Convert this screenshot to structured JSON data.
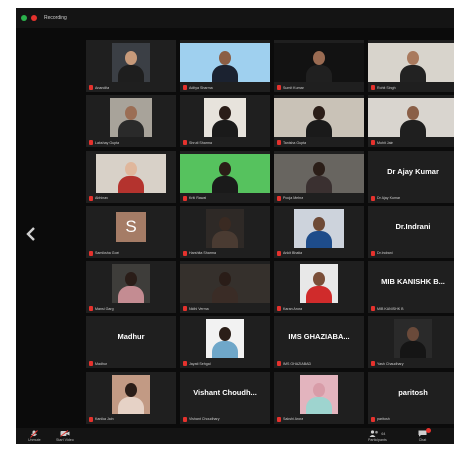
{
  "window": {
    "recording_label": "Recording"
  },
  "participants": [
    {
      "id": "p1",
      "name": "Anandita",
      "bg": "#3b3f45",
      "inset": [
        26,
        26
      ],
      "head": "#c79a7a",
      "body": "#1e1e1e"
    },
    {
      "id": "p2",
      "name": "Aditya Sharma",
      "bg": "#9fd0ef",
      "inset": [
        0,
        0
      ],
      "head": "#8b5e45",
      "body": "#1b2230"
    },
    {
      "id": "p3",
      "name": "Sumit Kumar",
      "bg": "#121212",
      "inset": [
        0,
        0
      ],
      "head": "#9a6b52",
      "body": "#202020"
    },
    {
      "id": "p4",
      "name": "Rohit Singh",
      "bg": "#d8d4cc",
      "inset": [
        0,
        0
      ],
      "head": "#a97a5e",
      "body": "#222222"
    },
    {
      "id": "p5",
      "name": "Lakshay Gupta",
      "bg": "#a8a39a",
      "inset": [
        24,
        24
      ],
      "head": "#9b6e55",
      "body": "#2a2a2a"
    },
    {
      "id": "p6",
      "name": "Shruti Sharma",
      "bg": "#e7e3dc",
      "inset": [
        24,
        24
      ],
      "head": "#2a1d18",
      "body": "#1a1a1a"
    },
    {
      "id": "p7",
      "name": "Tanisha Gupta",
      "bg": "#c9c2b7",
      "inset": [
        0,
        0
      ],
      "head": "#2b1e18",
      "body": "#1a1a1a"
    },
    {
      "id": "p8",
      "name": "Mohit Jain",
      "bg": "#d9d5cf",
      "inset": [
        0,
        0
      ],
      "head": "#8a5f47",
      "body": "#1f1f1f"
    },
    {
      "id": "p9",
      "name": "Abhinav",
      "bg": "#d8d1c8",
      "inset": [
        10,
        10
      ],
      "head": "#e0b79c",
      "body": "#b4332e"
    },
    {
      "id": "p10",
      "name": "Kriti Rawat",
      "bg": "#56c25e",
      "inset": [
        0,
        0
      ],
      "head": "#2a1d17",
      "body": "#1a1a1a"
    },
    {
      "id": "p11",
      "name": "Pooja Mehra",
      "bg": "#686560",
      "inset": [
        0,
        0
      ],
      "head": "#2b1e18",
      "body": "#3a3030"
    },
    {
      "id": "p12",
      "name": "Dr Ajay Kumar",
      "big": "Dr Ajay Kumar"
    },
    {
      "id": "p13",
      "name": "Samiksha Goel",
      "avatar": "S"
    },
    {
      "id": "p14",
      "name": "Harshita Sharma",
      "bg": "#2e2926",
      "inset": [
        26,
        26
      ],
      "head": "#3a2a22",
      "body": "#4a3b32"
    },
    {
      "id": "p15",
      "name": "Ankit Bhatia",
      "bg": "#cdd3dc",
      "inset": [
        20,
        20
      ],
      "head": "#6e4a36",
      "body": "#1e4c8a"
    },
    {
      "id": "p16",
      "name": "Dr.Indrani",
      "big": "Dr.Indrani"
    },
    {
      "id": "p17",
      "name": "Mansi Garg",
      "bg": "#3e3d3a",
      "inset": [
        26,
        26
      ],
      "head": "#2a1d18",
      "body": "#c48c92"
    },
    {
      "id": "p18",
      "name": "Nidhi Verma",
      "bg": "#35302c",
      "inset": [
        0,
        0
      ],
      "head": "#2a1d18",
      "body": "#3a2c26"
    },
    {
      "id": "p19",
      "name": "Karan Arora",
      "bg": "#e8e8e8",
      "inset": [
        26,
        26
      ],
      "head": "#7a4e38",
      "body": "#d02b2b"
    },
    {
      "id": "p20",
      "name": "MIB KANISHK B",
      "big": "MIB KANISHK B..."
    },
    {
      "id": "p21",
      "name": "Madhur",
      "big": "Madhur"
    },
    {
      "id": "p22",
      "name": "Jayati Sehgal",
      "bg": "#f2f2f2",
      "inset": [
        26,
        26
      ],
      "head": "#2b1e18",
      "body": "#6fa7c9"
    },
    {
      "id": "p23",
      "name": "IMS GHAZIABAD",
      "big": "IMS GHAZIABA..."
    },
    {
      "id": "p24",
      "name": "Yash Chaudhary",
      "bg": "#2a2a2a",
      "inset": [
        26,
        26
      ],
      "head": "#6a4a3a",
      "body": "#151515"
    },
    {
      "id": "p25",
      "name": "Kanika Jain",
      "bg": "#c29a84",
      "inset": [
        26,
        26
      ],
      "head": "#2a1d18",
      "body": "#e6d2c6"
    },
    {
      "id": "p26",
      "name": "Vishant Choudhary",
      "big": "Vishant Choudh..."
    },
    {
      "id": "p27",
      "name": "Sakshi Arora",
      "bg": "#e3b4be",
      "inset": [
        26,
        26
      ],
      "head": "#d89ca8",
      "body": "#9ed4cf"
    },
    {
      "id": "p28",
      "name": "paritosh",
      "big": "paritosh"
    }
  ],
  "toolbar": {
    "unmute_label": "Unmute",
    "video_label": "Start Video",
    "participants_label": "Participants",
    "participants_count": "64",
    "chat_label": "Chat"
  }
}
